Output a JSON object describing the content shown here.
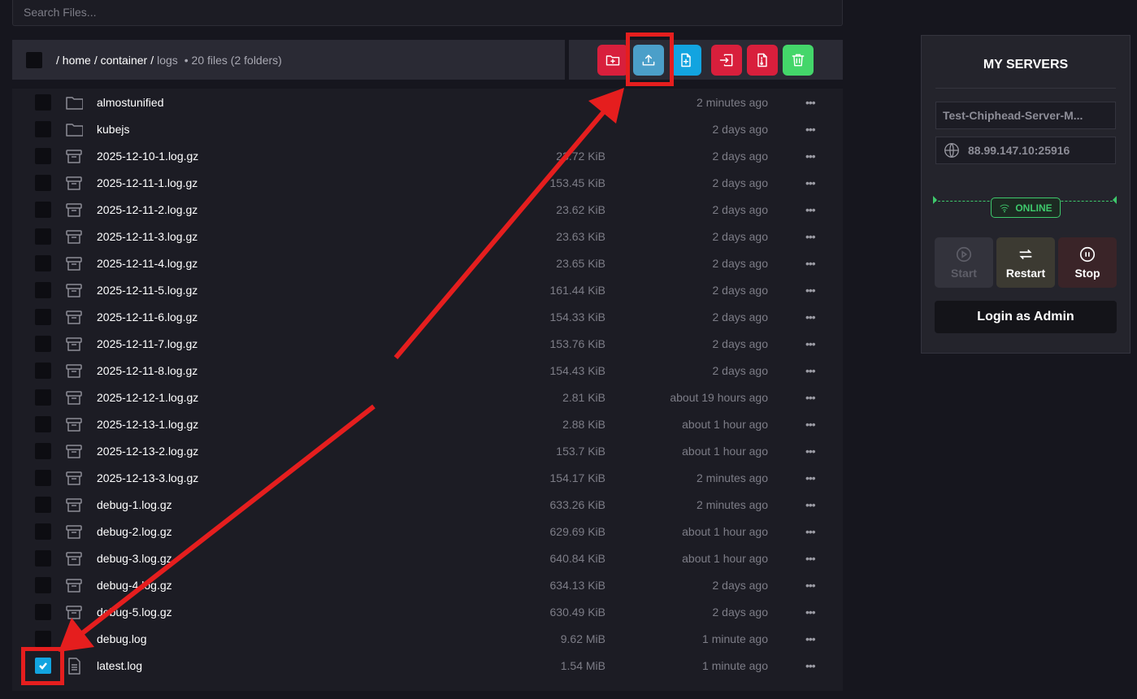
{
  "search": {
    "placeholder": "Search Files..."
  },
  "path": {
    "crumbs": [
      "/ home",
      "/ container",
      "/"
    ],
    "current": "logs",
    "summary": "• 20 files (2 folders)"
  },
  "actions": [
    {
      "name": "new-folder-button",
      "icon": "folder-plus-icon",
      "color": "#d81f3c"
    },
    {
      "name": "upload-button",
      "icon": "upload-icon",
      "color": "#4b9fc9"
    },
    {
      "name": "new-file-button",
      "icon": "file-plus-icon",
      "color": "#12a4e0"
    },
    {
      "name": "move-button",
      "icon": "move-in-icon",
      "color": "#d81f3c"
    },
    {
      "name": "archive-button",
      "icon": "file-zip-icon",
      "color": "#d81f3c"
    },
    {
      "name": "delete-button",
      "icon": "trash-icon",
      "color": "#44d66a"
    }
  ],
  "files": [
    {
      "name": "almostunified",
      "size": "",
      "date": "2 minutes ago",
      "type": "folder",
      "checked": false
    },
    {
      "name": "kubejs",
      "size": "",
      "date": "2 days ago",
      "type": "folder",
      "checked": false
    },
    {
      "name": "2025-12-10-1.log.gz",
      "size": "23.72 KiB",
      "date": "2 days ago",
      "type": "archive",
      "checked": false
    },
    {
      "name": "2025-12-11-1.log.gz",
      "size": "153.45 KiB",
      "date": "2 days ago",
      "type": "archive",
      "checked": false
    },
    {
      "name": "2025-12-11-2.log.gz",
      "size": "23.62 KiB",
      "date": "2 days ago",
      "type": "archive",
      "checked": false
    },
    {
      "name": "2025-12-11-3.log.gz",
      "size": "23.63 KiB",
      "date": "2 days ago",
      "type": "archive",
      "checked": false
    },
    {
      "name": "2025-12-11-4.log.gz",
      "size": "23.65 KiB",
      "date": "2 days ago",
      "type": "archive",
      "checked": false
    },
    {
      "name": "2025-12-11-5.log.gz",
      "size": "161.44 KiB",
      "date": "2 days ago",
      "type": "archive",
      "checked": false
    },
    {
      "name": "2025-12-11-6.log.gz",
      "size": "154.33 KiB",
      "date": "2 days ago",
      "type": "archive",
      "checked": false
    },
    {
      "name": "2025-12-11-7.log.gz",
      "size": "153.76 KiB",
      "date": "2 days ago",
      "type": "archive",
      "checked": false
    },
    {
      "name": "2025-12-11-8.log.gz",
      "size": "154.43 KiB",
      "date": "2 days ago",
      "type": "archive",
      "checked": false
    },
    {
      "name": "2025-12-12-1.log.gz",
      "size": "2.81 KiB",
      "date": "about 19 hours ago",
      "type": "archive",
      "checked": false
    },
    {
      "name": "2025-12-13-1.log.gz",
      "size": "2.88 KiB",
      "date": "about 1 hour ago",
      "type": "archive",
      "checked": false
    },
    {
      "name": "2025-12-13-2.log.gz",
      "size": "153.7 KiB",
      "date": "about 1 hour ago",
      "type": "archive",
      "checked": false
    },
    {
      "name": "2025-12-13-3.log.gz",
      "size": "154.17 KiB",
      "date": "2 minutes ago",
      "type": "archive",
      "checked": false
    },
    {
      "name": "debug-1.log.gz",
      "size": "633.26 KiB",
      "date": "2 minutes ago",
      "type": "archive",
      "checked": false
    },
    {
      "name": "debug-2.log.gz",
      "size": "629.69 KiB",
      "date": "about 1 hour ago",
      "type": "archive",
      "checked": false
    },
    {
      "name": "debug-3.log.gz",
      "size": "640.84 KiB",
      "date": "about 1 hour ago",
      "type": "archive",
      "checked": false
    },
    {
      "name": "debug-4.log.gz",
      "size": "634.13 KiB",
      "date": "2 days ago",
      "type": "archive",
      "checked": false
    },
    {
      "name": "debug-5.log.gz",
      "size": "630.49 KiB",
      "date": "2 days ago",
      "type": "archive",
      "checked": false
    },
    {
      "name": "debug.log",
      "size": "9.62 MiB",
      "date": "1 minute ago",
      "type": "text",
      "checked": false
    },
    {
      "name": "latest.log",
      "size": "1.54 MiB",
      "date": "1 minute ago",
      "type": "text",
      "checked": true
    }
  ],
  "row_menu": "•••",
  "server": {
    "title": "MY SERVERS",
    "name": "Test-Chiphead-Server-M...",
    "address": "88.99.147.10:25916",
    "status": "ONLINE",
    "status_color": "#3ec96c",
    "start": "Start",
    "restart": "Restart",
    "stop": "Stop",
    "login": "Login as Admin"
  },
  "annotation_color": "#e51e1e"
}
